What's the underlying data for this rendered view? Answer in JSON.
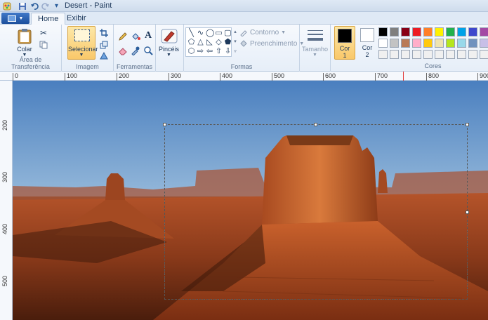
{
  "window": {
    "title": "Desert - Paint"
  },
  "quick_access": {
    "icons": [
      "paint-app-icon",
      "save-icon",
      "undo-icon",
      "redo-icon",
      "customize-icon"
    ]
  },
  "tabs": [
    {
      "label": "Home",
      "active": true
    },
    {
      "label": "Exibir",
      "active": false
    }
  ],
  "ribbon": {
    "clipboard": {
      "paste_label": "Colar",
      "group_label": "Área de Transferência"
    },
    "image": {
      "select_label": "Selecionar",
      "group_label": "Imagem"
    },
    "tools": {
      "group_label": "Ferramentas"
    },
    "brushes": {
      "label": "Pincéis"
    },
    "shapes": {
      "outline_label": "Contorno",
      "fill_label": "Preenchimento",
      "group_label": "Formas"
    },
    "size": {
      "label": "Tamanho"
    },
    "colors": {
      "color1_label": "Cor 1",
      "color2_label": "Cor 2",
      "group_label": "Cores",
      "color1": "#000000",
      "color2": "#ffffff",
      "palette_row1": [
        "#000000",
        "#7f7f7f",
        "#880015",
        "#ed1c24",
        "#ff7f27",
        "#fff200",
        "#22b14c",
        "#00a2e8",
        "#3f48cc",
        "#a349a4"
      ],
      "palette_row2": [
        "#ffffff",
        "#c3c3c3",
        "#b97a57",
        "#ffaec9",
        "#ffc90e",
        "#efe4b0",
        "#b5e61d",
        "#99d9ea",
        "#7092be",
        "#c8bfe7"
      ],
      "palette_row3": [
        "#f0f0f0",
        "#f0f0f0",
        "#f0f0f0",
        "#f0f0f0",
        "#f0f0f0",
        "#f0f0f0",
        "#f0f0f0",
        "#f0f0f0",
        "#f0f0f0",
        "#f0f0f0"
      ]
    }
  },
  "ruler": {
    "top_ticks": [
      "0",
      "100",
      "200",
      "300",
      "400",
      "500",
      "600",
      "700",
      "800",
      "900"
    ],
    "left_ticks": [
      "200",
      "300",
      "400",
      "500"
    ]
  },
  "canvas": {
    "image_name": "desert-landscape-image"
  }
}
